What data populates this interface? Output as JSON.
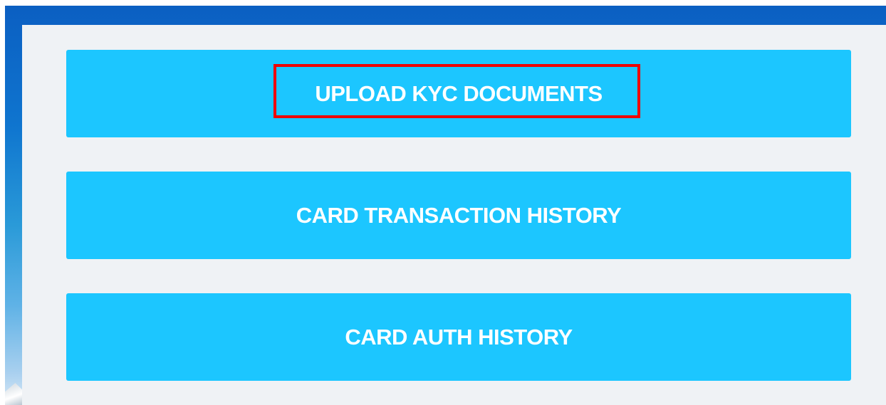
{
  "actions": {
    "upload_kyc": "UPLOAD KYC DOCUMENTS",
    "card_transaction_history": "CARD TRANSACTION HISTORY",
    "card_auth_history": "CARD AUTH HISTORY"
  },
  "colors": {
    "button_background": "#1cc6ff",
    "button_text": "#ffffff",
    "panel_background": "#eff2f5",
    "highlight_border": "#ee0000",
    "frame_top": "#0b5fc2"
  }
}
